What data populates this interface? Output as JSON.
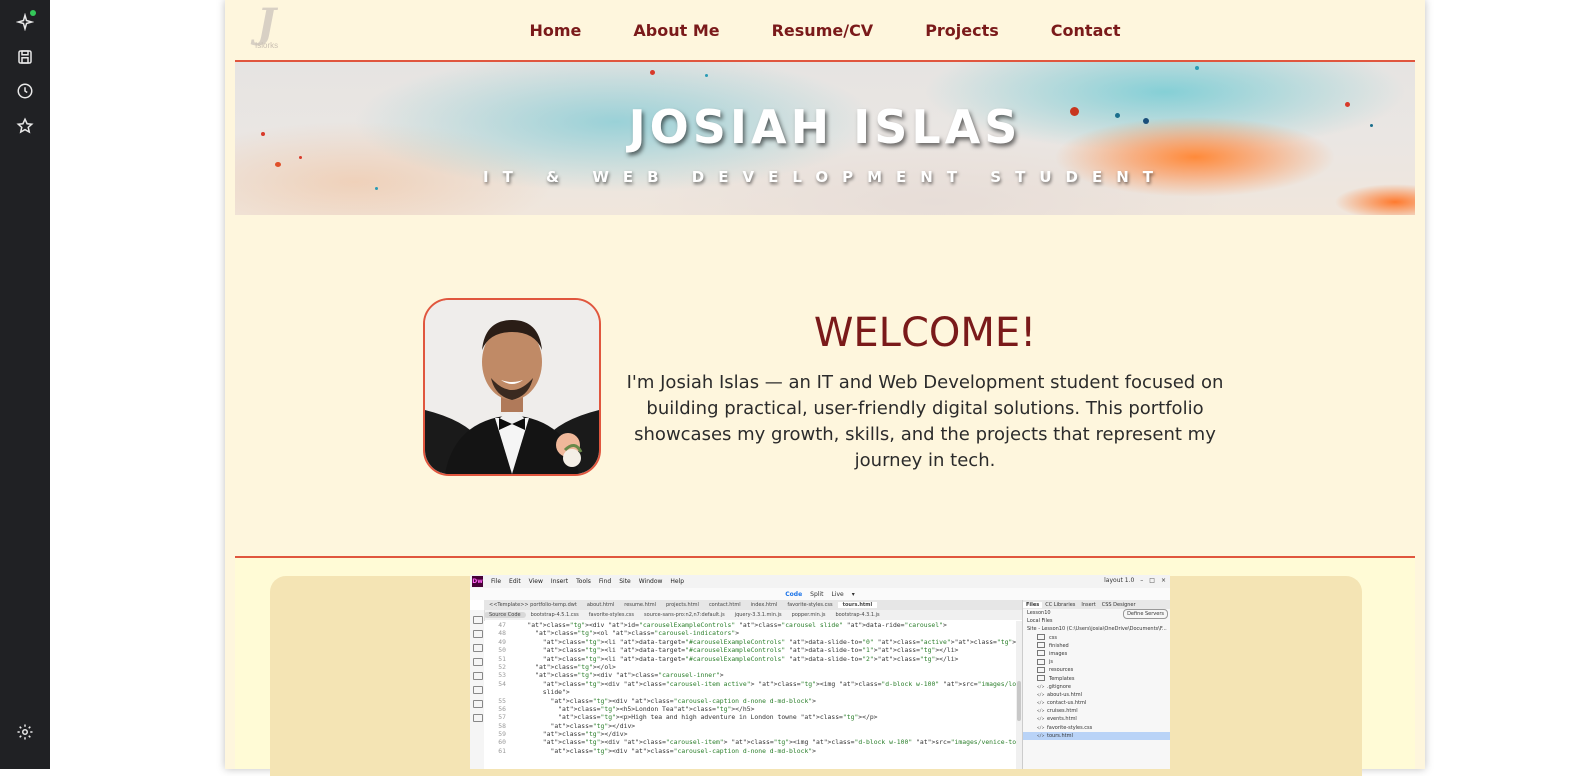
{
  "sidebar": {
    "icons": [
      "sparkle-icon",
      "save-page-icon",
      "history-icon",
      "star-icon"
    ],
    "settings_icon": "gear-icon"
  },
  "nav": {
    "logo_letter": "J",
    "logo_sub": "Islorks",
    "links": [
      "Home",
      "About Me",
      "Resume/CV",
      "Projects",
      "Contact"
    ]
  },
  "banner": {
    "title": "JOSIAH ISLAS",
    "subtitle": "IT & WEB DEVELOPMENT STUDENT"
  },
  "welcome": {
    "heading": "WELCOME!",
    "text": "I'm Josiah Islas — an IT and Web Development student focused on building practical, user-friendly digital solutions. This portfolio showcases my growth, skills, and the projects that represent my journey in tech."
  },
  "dreamweaver": {
    "logo": "Dw",
    "menus": [
      "File",
      "Edit",
      "View",
      "Insert",
      "Tools",
      "Find",
      "Site",
      "Window",
      "Help"
    ],
    "layout_label": "layout 1.0",
    "views": [
      "Code",
      "Split",
      "Live"
    ],
    "tabs": [
      "<<Template>> portfolio-temp.dwt",
      "about.html",
      "resume.html",
      "projects.html",
      "contact.html",
      "index.html",
      "favorite-styles.css",
      "tours.html"
    ],
    "related_files": [
      "Source Code",
      "bootstrap-4.5.1.css",
      "favorite-styles.css",
      "source-sans-pro:n2,n7:default.js",
      "jquery-3.3.1.min.js",
      "popper.min.js",
      "bootstrap-4.3.1.js"
    ],
    "code_lines": [
      {
        "n": "47",
        "code": "    <div id=\"carouselExampleControls\" class=\"carousel slide\" data-ride=\"carousel\">"
      },
      {
        "n": "48",
        "code": "      <ol class=\"carousel-indicators\">"
      },
      {
        "n": "49",
        "code": "        <li data-target=\"#carouselExampleControls\" data-slide-to=\"0\" class=\"active\"></li>"
      },
      {
        "n": "50",
        "code": "        <li data-target=\"#carouselExampleControls\" data-slide-to=\"1\"></li>"
      },
      {
        "n": "51",
        "code": "        <li data-target=\"#carouselExampleControls\" data-slide-to=\"2\"></li>"
      },
      {
        "n": "52",
        "code": "      </ol>"
      },
      {
        "n": "53",
        "code": "      <div class=\"carousel-inner\">"
      },
      {
        "n": "54",
        "code": "        <div class=\"carousel-item active\"> <img class=\"d-block w-100\" src=\"images/london-tour-carousel.jpg\" alt=\"First"
      },
      {
        "n": "",
        "code": "        slide\">"
      },
      {
        "n": "55",
        "code": "          <div class=\"carousel-caption d-none d-md-block\">"
      },
      {
        "n": "56",
        "code": "            <h5>London Tea</h5>"
      },
      {
        "n": "57",
        "code": "            <p>High tea and high adventure in London towne </p>"
      },
      {
        "n": "58",
        "code": "          </div>"
      },
      {
        "n": "59",
        "code": "        </div>"
      },
      {
        "n": "60",
        "code": "        <div class=\"carousel-item\"> <img class=\"d-block w-100\" src=\"images/venice-tour-carousel.jpg\" alt=\"Second slide\">"
      },
      {
        "n": "61",
        "code": "          <div class=\"carousel-caption d-none d-md-block\">"
      }
    ],
    "panel_tabs": [
      "Files",
      "CC Libraries",
      "Insert",
      "CSS Designer"
    ],
    "site_select": "Lesson10",
    "define_servers": "Define Servers",
    "local_files": "Local Files",
    "site_root": "Site - Lesson10 (C:\\Users\\josia\\OneDrive\\Documents\\F...",
    "folders": [
      "css",
      "finished",
      "images",
      "js",
      "resources",
      "Templates"
    ],
    "files": [
      ".gitignore",
      "about-us.html",
      "contact-us.html",
      "cruises.html",
      "events.html",
      "favorite-styles.css",
      "tours.html"
    ]
  }
}
